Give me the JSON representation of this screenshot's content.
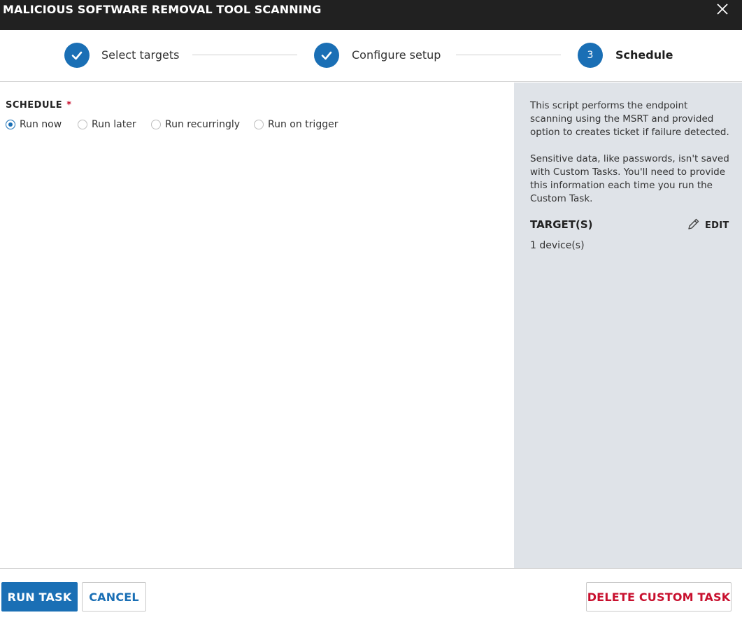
{
  "window": {
    "title": "MALICIOUS SOFTWARE REMOVAL TOOL SCANNING",
    "close_icon": "close-icon"
  },
  "stepper": {
    "steps": [
      {
        "label": "Select targets",
        "state": "complete",
        "marker": "✓"
      },
      {
        "label": "Configure setup",
        "state": "complete",
        "marker": "✓"
      },
      {
        "label": "Schedule",
        "state": "active",
        "marker": "3"
      }
    ]
  },
  "schedule": {
    "label": "SCHEDULE",
    "required_mark": "*",
    "options": [
      {
        "label": "Run now",
        "selected": true
      },
      {
        "label": "Run later",
        "selected": false
      },
      {
        "label": "Run recurringly",
        "selected": false
      },
      {
        "label": "Run on trigger",
        "selected": false
      }
    ]
  },
  "side_panel": {
    "description_1": "This script performs the endpoint scanning using the MSRT and provided option to creates ticket if failure detected.",
    "description_2": "Sensitive data, like passwords, isn't saved with Custom Tasks. You'll need to provide this information each time you run the Custom Task.",
    "targets_heading": "TARGET(S)",
    "edit_label": "EDIT",
    "target_count": "1 device(s)"
  },
  "footer": {
    "run_label": "RUN TASK",
    "cancel_label": "CANCEL",
    "delete_label": "DELETE CUSTOM TASK"
  },
  "colors": {
    "accent": "#1a6fb5",
    "danger": "#c8102e",
    "titlebar": "#212121",
    "side_panel": "#dfe3e8"
  }
}
